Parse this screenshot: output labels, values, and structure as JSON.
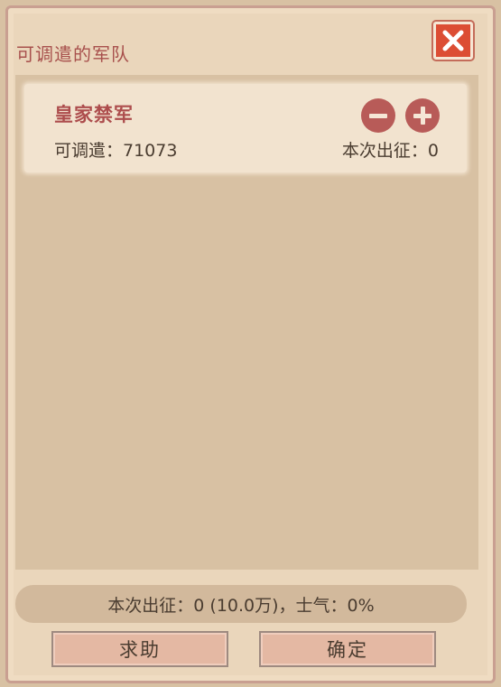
{
  "dialog": {
    "title": "可调遣的军队"
  },
  "units": [
    {
      "name": "皇家禁军",
      "available_label": "可调遣：71073",
      "dispatch_label": "本次出征：0"
    }
  ],
  "summary": {
    "text": "本次出征：0 (10.0万)，士气：0%"
  },
  "buttons": {
    "help": "求助",
    "confirm": "确定"
  },
  "colors": {
    "accent_red": "#dc4d34",
    "title_red": "#a8514d",
    "panel_bg": "#ead6bb",
    "inner_bg": "#d8c1a3"
  },
  "icons": {
    "close": "close-icon",
    "minus": "minus-icon",
    "plus": "plus-icon"
  }
}
